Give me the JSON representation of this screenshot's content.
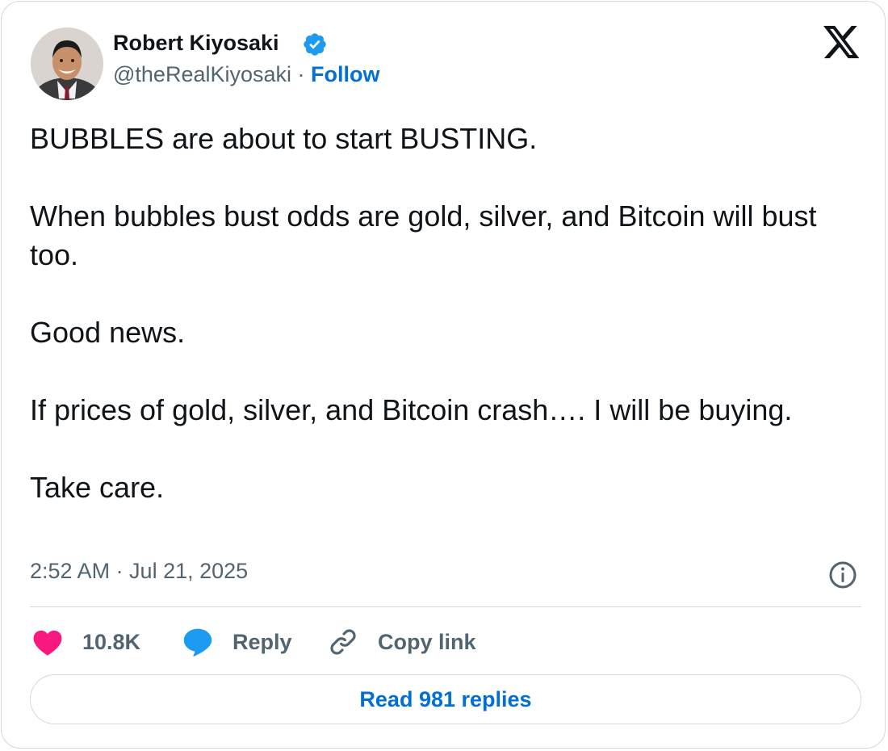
{
  "author": {
    "name": "Robert Kiyosaki",
    "handle": "@theRealKiyosaki",
    "separator": "·",
    "follow_label": "Follow",
    "verified_icon": "verified-badge-icon",
    "avatar_icon": "profile-photo"
  },
  "platform_icon": "x-logo-icon",
  "tweet": {
    "lines": [
      "BUBBLES are about to start BUSTING.",
      "When bubbles bust odds are gold, silver, and Bitcoin will bust too.",
      "Good news.",
      "If prices of gold, silver, and Bitcoin crash…. I will be buying.",
      "Take care."
    ],
    "timestamp": "2:52 AM · Jul 21, 2025"
  },
  "actions": {
    "like_count": "10.8K",
    "reply_label": "Reply",
    "copy_link_label": "Copy link",
    "read_replies_label": "Read 981 replies"
  },
  "colors": {
    "text": "#0f1419",
    "secondary": "#536471",
    "link": "#006fd6",
    "like": "#f91880",
    "reply": "#1d9bf0",
    "border": "#cfd9de"
  }
}
